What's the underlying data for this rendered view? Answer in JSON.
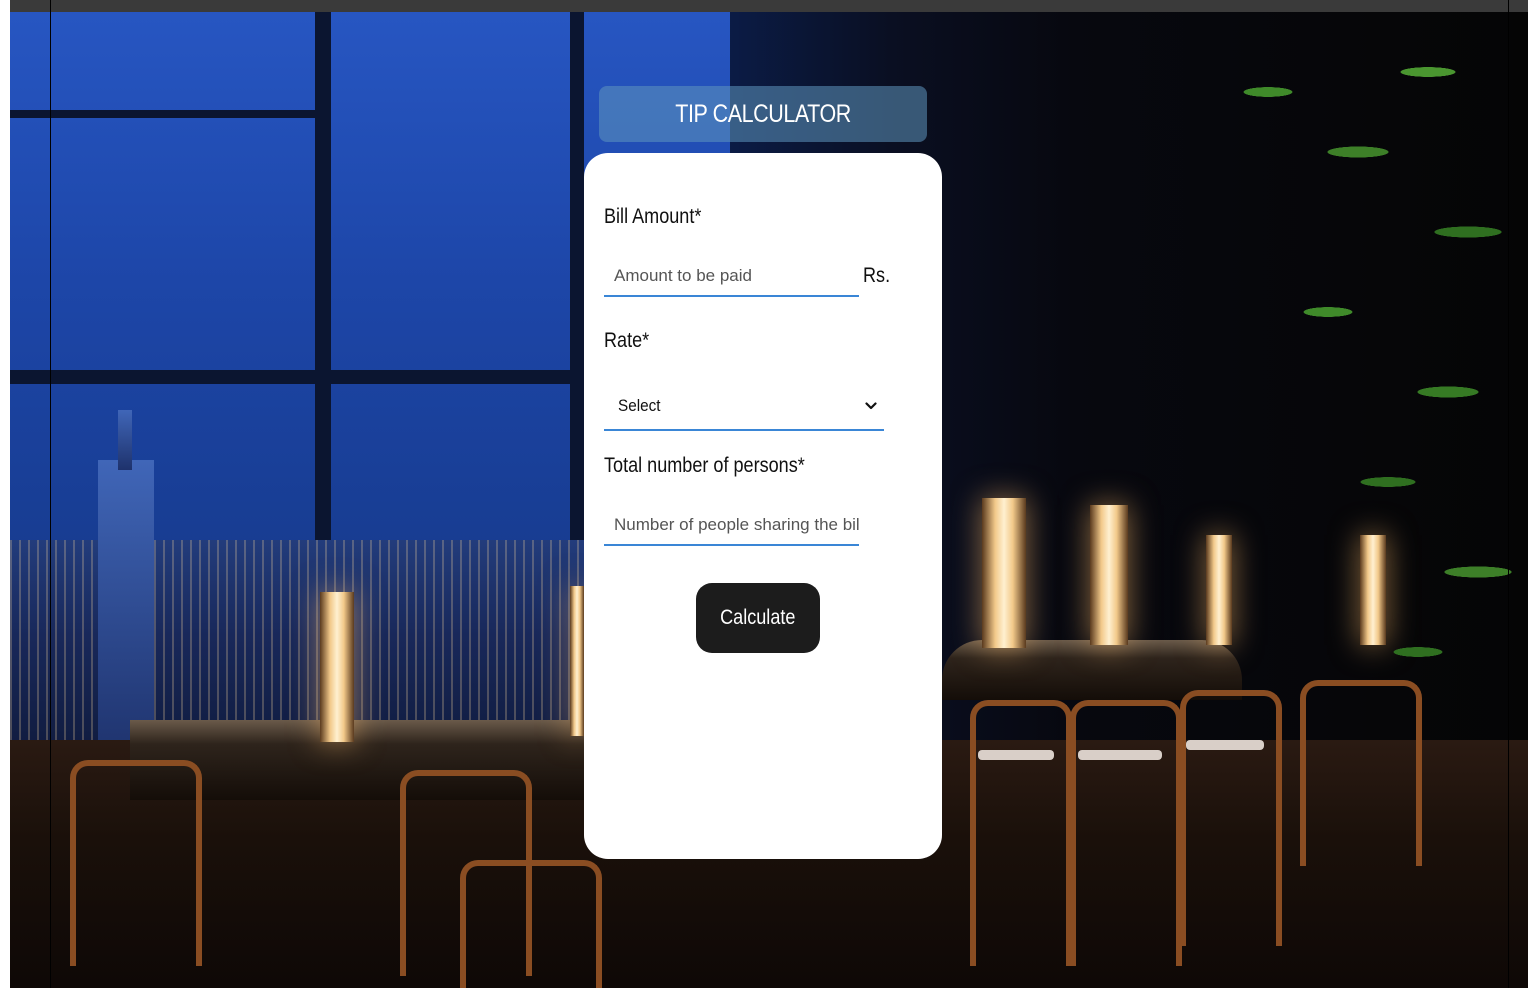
{
  "app": {
    "title": "TIP CALCULATOR"
  },
  "form": {
    "bill_amount": {
      "label": "Bill Amount*",
      "placeholder": "Amount to be paid",
      "value": "",
      "unit": "Rs."
    },
    "rate": {
      "label": "Rate*",
      "selected": "Select"
    },
    "persons": {
      "label": "Total number of persons*",
      "placeholder": "Number of people sharing the bill",
      "value": ""
    },
    "calculate_label": "Calculate"
  },
  "icons": {
    "rate_dropdown": "chevron-down-icon"
  },
  "colors": {
    "banner": "#5f96be",
    "input_underline": "#3a86d6",
    "button_bg": "#1c1c1c",
    "card_bg": "#ffffff"
  }
}
